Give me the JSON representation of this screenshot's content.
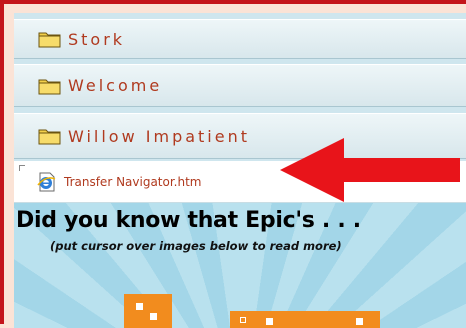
{
  "folders": [
    {
      "label": "Stork",
      "icon": "folder-icon"
    },
    {
      "label": "Welcome",
      "icon": "folder-icon"
    },
    {
      "label": "Willow Impatient",
      "icon": "folder-icon"
    }
  ],
  "file": {
    "label": "Transfer Navigator.htm",
    "icon": "ie-document-icon"
  },
  "banner": {
    "title": "Did you know that Epic's . . .",
    "subtitle": "(put cursor over images below to read more)"
  },
  "colors": {
    "border": "#c4141a",
    "arrow": "#e8141a",
    "label": "#b03a1f",
    "orange": "#f28c1e"
  }
}
